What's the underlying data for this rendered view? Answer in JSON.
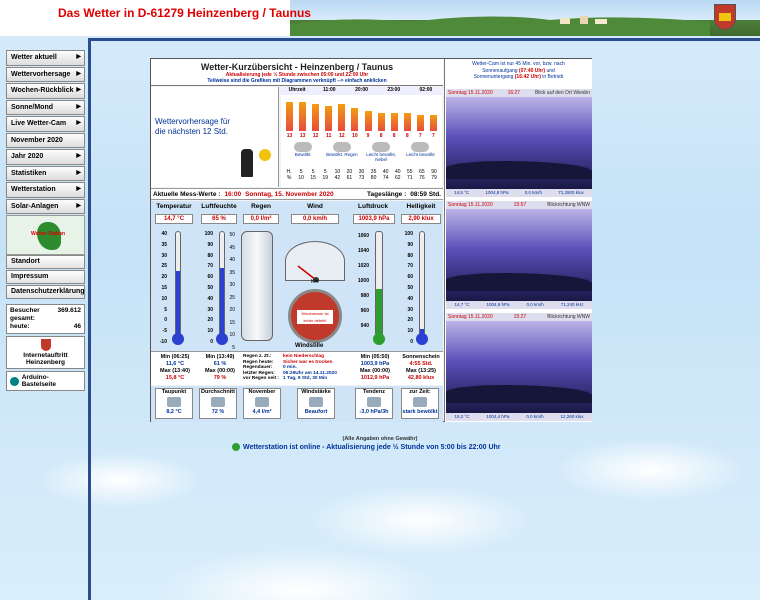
{
  "header": {
    "title": "Das Wetter in  D-61279 Heinzenberg / Taunus"
  },
  "nav": [
    {
      "label": "Wetter aktuell"
    },
    {
      "label": "Wettervorhersage"
    },
    {
      "label": "Wochen-Rückblick"
    },
    {
      "label": "Sonne/Mond"
    },
    {
      "label": "Live Wetter-Cam"
    },
    {
      "label": "November 2020"
    },
    {
      "label": "Jahr 2020"
    },
    {
      "label": "Statistiken"
    },
    {
      "label": "Wetterstation"
    },
    {
      "label": "Solar-Anlagen"
    }
  ],
  "bubble_label": "Wetter-Station",
  "links": [
    {
      "label": "Standort"
    },
    {
      "label": "Impressum"
    },
    {
      "label": "Datenschutzerklärung"
    }
  ],
  "visitors": {
    "label_total": "Besucher gesamt:",
    "total": "369.612",
    "label_today": "heute:",
    "today": "46"
  },
  "badge": "Internetauftritt Heinzenberg",
  "arduino": "Arduino-Bastelseite",
  "overview": {
    "title": "Wetter-Kurzübersicht   -   Heinzenberg / Taunus",
    "sub1": "Aktualisierung jede ½ Stunde zwischen 05:00 und 22:00 Uhr",
    "sub2": "Teilweise sind die Grafiken mit Diagrammen verknüpft --> einfach anklicken",
    "forecast_text": "Wettervorhersage für die nächsten 12 Std."
  },
  "forecast": {
    "hours": [
      "Uhrzeit",
      "11:00",
      "20:00",
      "23:00",
      "02:00"
    ],
    "temps": [
      "13",
      "13",
      "12",
      "11",
      "12",
      "10",
      "9",
      "8",
      "8",
      "8",
      "7",
      "7"
    ],
    "bar_values": [
      13,
      13,
      12,
      11,
      12,
      10,
      9,
      8,
      8,
      8,
      7,
      7
    ],
    "icons": [
      {
        "label": "Bewölkt"
      },
      {
        "label": "Bewölkt, Regen"
      },
      {
        "label": "Leicht bewölkt, Nebel"
      },
      {
        "label": "Leicht bewölkt"
      }
    ],
    "row1": [
      "H.",
      "5",
      "5",
      "5",
      "10",
      "20",
      "30",
      "35",
      "40",
      "40",
      "55",
      "65",
      "90"
    ],
    "row2": [
      "%",
      "10",
      "15",
      "19",
      "42",
      "61",
      "73",
      "80",
      "74",
      "62",
      "71",
      "76",
      "79"
    ]
  },
  "current": {
    "label": "Aktuelle Mess-Werte :",
    "time": "16:00",
    "date": "Sonntag, 15. November 2020",
    "daylength_label": "Tageslänge :",
    "daylength": "08:59 Std."
  },
  "instruments": {
    "temp": {
      "head": "Temperatur",
      "value": "14,7 °C",
      "level": 0.62
    },
    "humidity": {
      "head": "Luftfeuchte",
      "value": "65 %",
      "level": 0.65
    },
    "rain": {
      "head": "Regen",
      "value": "0,0 l/m²"
    },
    "wind": {
      "head": "Wind",
      "value": "0,0 km/h",
      "gauge_text": "Windmesser ist leider defekt!",
      "calm": "Windstille",
      "unit": "Km"
    },
    "pressure": {
      "head": "Luftdruck",
      "value": "1003,9 hPa",
      "level": 0.45
    },
    "brightness": {
      "head": "Helligkeit",
      "value": "2,90 klux",
      "level": 0.06
    },
    "temp_ticks": [
      "40",
      "35",
      "30",
      "25",
      "20",
      "15",
      "10",
      "5",
      "0",
      "-5",
      "-10"
    ],
    "hum_ticks": [
      "100",
      "90",
      "80",
      "70",
      "60",
      "50",
      "40",
      "30",
      "20",
      "10",
      "0"
    ],
    "rain_ticks": [
      "50",
      "45",
      "40",
      "35",
      "30",
      "25",
      "20",
      "15",
      "10",
      "5"
    ],
    "press_ticks": [
      "1060",
      "1040",
      "1020",
      "1000",
      "980",
      "960",
      "940"
    ],
    "bright_ticks": [
      "100",
      "90",
      "80",
      "70",
      "60",
      "50",
      "40",
      "30",
      "20",
      "10",
      "0"
    ]
  },
  "stats": {
    "temp": {
      "min_label": "Min (06:25)",
      "min": "11,6 °C",
      "max_label": "Max (13:40)",
      "max": "15,8 °C"
    },
    "hum": {
      "min_label": "Min (13:49)",
      "min": "61 %",
      "max_label": "Max (00:00)",
      "max": "79 %"
    },
    "rain": {
      "l1": "Regen z. Zt.:",
      "l2": "Regen heute:",
      "l3": "Regendauer:",
      "l4": "letzter Regen:",
      "l5": "vor Regen seit :",
      "v1": "kein Niederschlag",
      "v2": "Sicher war es trocken",
      "v3": "0 min.",
      "v4": "06:29Uhr am 14.11.2020",
      "v5": "1 Tag, 9 Std, 30 Min"
    },
    "press": {
      "min_label": "Min (05:50)",
      "min": "1003,9 hPa",
      "max_label": "Max (00:00)",
      "max": "1012,9 hPa"
    },
    "bright": {
      "l1": "Sonnenschein",
      "v1": "4:55 Std.",
      "max_label": "Max (13:25)",
      "max": "42,80 klux"
    }
  },
  "tiles": [
    {
      "title": "Taupunkt",
      "value": "8,2 °C"
    },
    {
      "title": "Durchschnitt",
      "value": "72 %"
    },
    {
      "title": "November",
      "value": "4,4 l/m²"
    },
    {
      "title": "Windstärke",
      "value": "Beaufort"
    },
    {
      "title": "Tendenz",
      "value": "-3,0 hPa/3h"
    },
    {
      "title": "zur Zeit:",
      "value": "stark bewölkt"
    }
  ],
  "cam": {
    "head1": "Wetter-Cam ist nur 45 Min. vor, bzw. nach",
    "head2": "Sonnenaufgang",
    "sunrise": "(07:40 Uhr)",
    "head3": "und",
    "head4": "Sonnenuntergang",
    "sunset": "(16:42 Uhr)",
    "head5": "in Betrieb",
    "images": [
      {
        "date": "Sonntag 15.11.2020",
        "time": "16:27",
        "view": "Blick auf den Ort Wiesbn",
        "ft": [
          "14,5 °C",
          "1004,8 hPa",
          "0,0 km/h",
          "71,2800 klux"
        ]
      },
      {
        "date": "Sonntag 15.11.2020",
        "time": "15:57",
        "view": "Blickrichtung WNW",
        "ft": [
          "14,7 °C",
          "1004,9 hPa",
          "0,0 km/h",
          "71,240 kHz"
        ]
      },
      {
        "date": "Sonntag 15.11.2020",
        "time": "15:27",
        "view": "Blickrichtung WNW",
        "ft": [
          "15,2 °C",
          "1004,4 hPa",
          "0,0 km/h",
          "12,260 klux"
        ]
      }
    ]
  },
  "footer": {
    "note": "(Alle Angaben ohne Gewähr)",
    "online": "Wetterstation ist online - Aktualisierung jede ½ Stunde von 5:00 bis 22:00 Uhr"
  }
}
